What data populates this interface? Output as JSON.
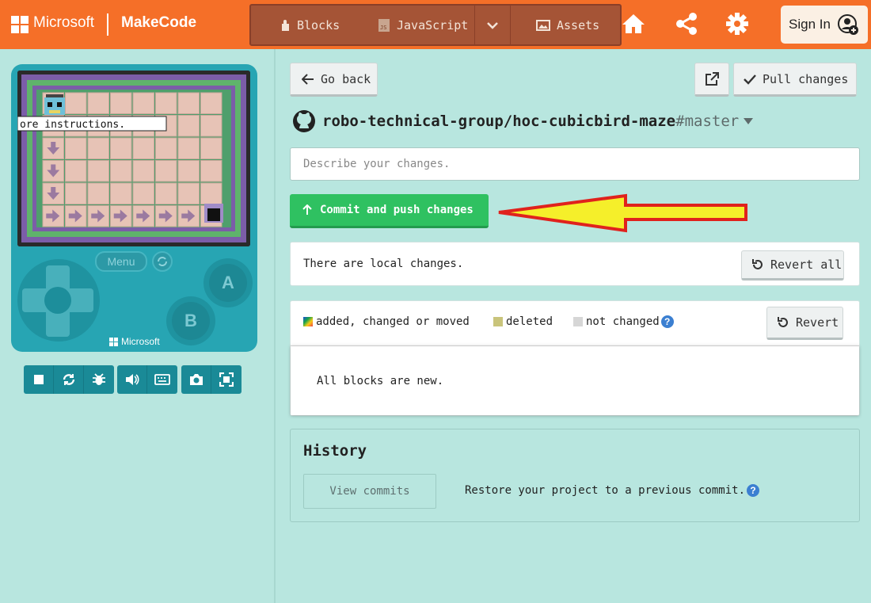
{
  "header": {
    "brand": "Microsoft",
    "product": "MakeCode",
    "modes": [
      {
        "label": "Blocks",
        "icon": "puzzle-icon"
      },
      {
        "label": "JavaScript",
        "icon": "js-file-icon"
      },
      {
        "label": "Assets",
        "icon": "image-icon"
      }
    ],
    "sign_in_label": "Sign In",
    "accent_color": "#f56f28"
  },
  "simulator": {
    "overlay_text": "ore instructions.",
    "menu_label": "Menu",
    "a_label": "A",
    "b_label": "B",
    "brand_label": "Microsoft",
    "toolbar_icons": [
      "stop-icon",
      "restart-icon",
      "debug-icon",
      "sound-icon",
      "keyboard-icon",
      "screenshot-icon",
      "fullscreen-icon"
    ]
  },
  "github": {
    "go_back_label": "Go back",
    "pull_label": "Pull changes",
    "repo": "robo-technical-group/hoc-cubicbird-maze",
    "branch": "#master",
    "description_placeholder": "Describe your changes.",
    "commit_label": "Commit and push changes",
    "local_changes_text": "There are local changes.",
    "revert_all_label": "Revert all",
    "legend": {
      "added": "added, changed or moved",
      "deleted": "deleted",
      "not_changed": "not changed"
    },
    "revert_label": "Revert",
    "diff_message": "All blocks are new.",
    "history_title": "History",
    "view_commits_label": "View commits",
    "restore_text": "Restore your project to a previous commit.",
    "help_glyph": "?"
  }
}
